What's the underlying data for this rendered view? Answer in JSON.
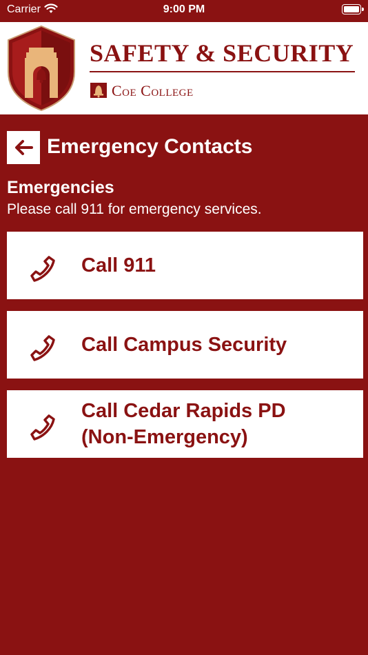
{
  "status_bar": {
    "carrier": "Carrier",
    "time": "9:00 PM"
  },
  "header": {
    "title": "SAFETY & SECURITY",
    "college_name": "Coe College",
    "logo_icon": "shield-bell-tower-icon",
    "college_icon": "coe-bell-icon"
  },
  "page": {
    "title": "Emergency Contacts",
    "back_icon": "arrow-left-icon"
  },
  "section": {
    "heading": "Emergencies",
    "description": "Please call 911 for emergency services."
  },
  "contacts": [
    {
      "label": "Call 911",
      "icon": "phone-icon"
    },
    {
      "label": "Call Campus Security",
      "icon": "phone-icon"
    },
    {
      "label": "Call Cedar Rapids PD (Non-Emergency)",
      "icon": "phone-icon"
    }
  ],
  "colors": {
    "primary": "#8a1212",
    "gold": "#e9b57a",
    "white": "#ffffff"
  }
}
